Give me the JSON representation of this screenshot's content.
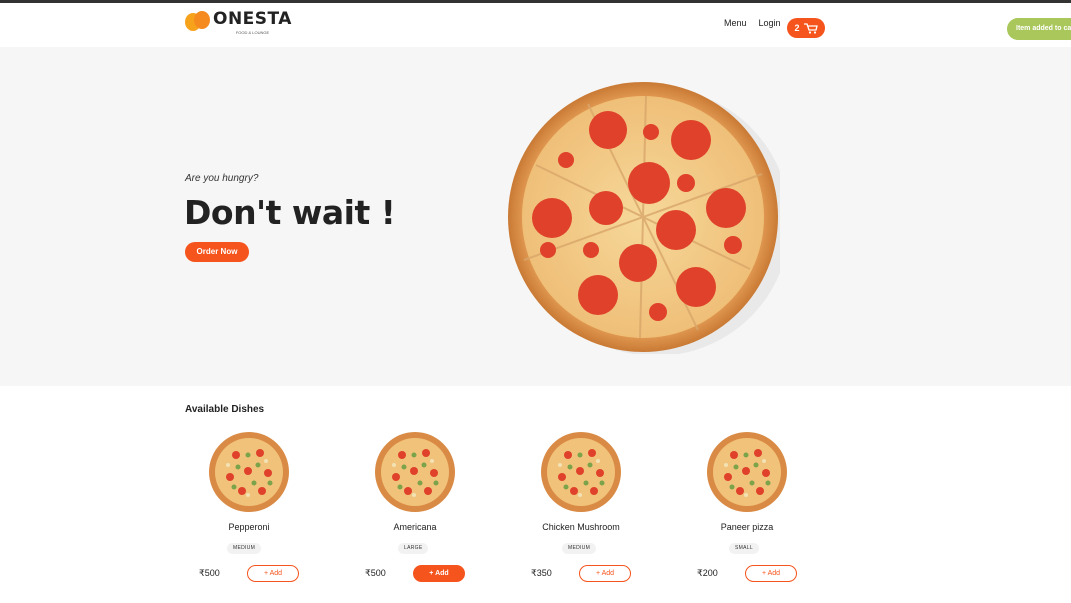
{
  "brand": {
    "name": "ONESTA",
    "tagline": "FOOD & LOUNGE"
  },
  "nav": {
    "menu": "Menu",
    "login": "Login"
  },
  "cart": {
    "count": "2"
  },
  "toast": {
    "text": "Item added to cart"
  },
  "hero": {
    "subtitle": "Are you hungry?",
    "title": "Don't wait !",
    "cta": "Order Now"
  },
  "dishes": {
    "title": "Available Dishes",
    "items": [
      {
        "name": "Pepperoni",
        "size": "MEDIUM",
        "price": "₹500",
        "add": "+   Add",
        "active": false
      },
      {
        "name": "Americana",
        "size": "LARGE",
        "price": "₹500",
        "add": "+   Add",
        "active": true
      },
      {
        "name": "Chicken Mushroom",
        "size": "MEDIUM",
        "price": "₹350",
        "add": "+   Add",
        "active": false
      },
      {
        "name": "Paneer pizza",
        "size": "SMALL",
        "price": "₹200",
        "add": "+   Add",
        "active": false
      }
    ]
  },
  "colors": {
    "accent": "#f5541c",
    "toast": "#a9c75b",
    "hero_bg": "#f6f6f6"
  }
}
